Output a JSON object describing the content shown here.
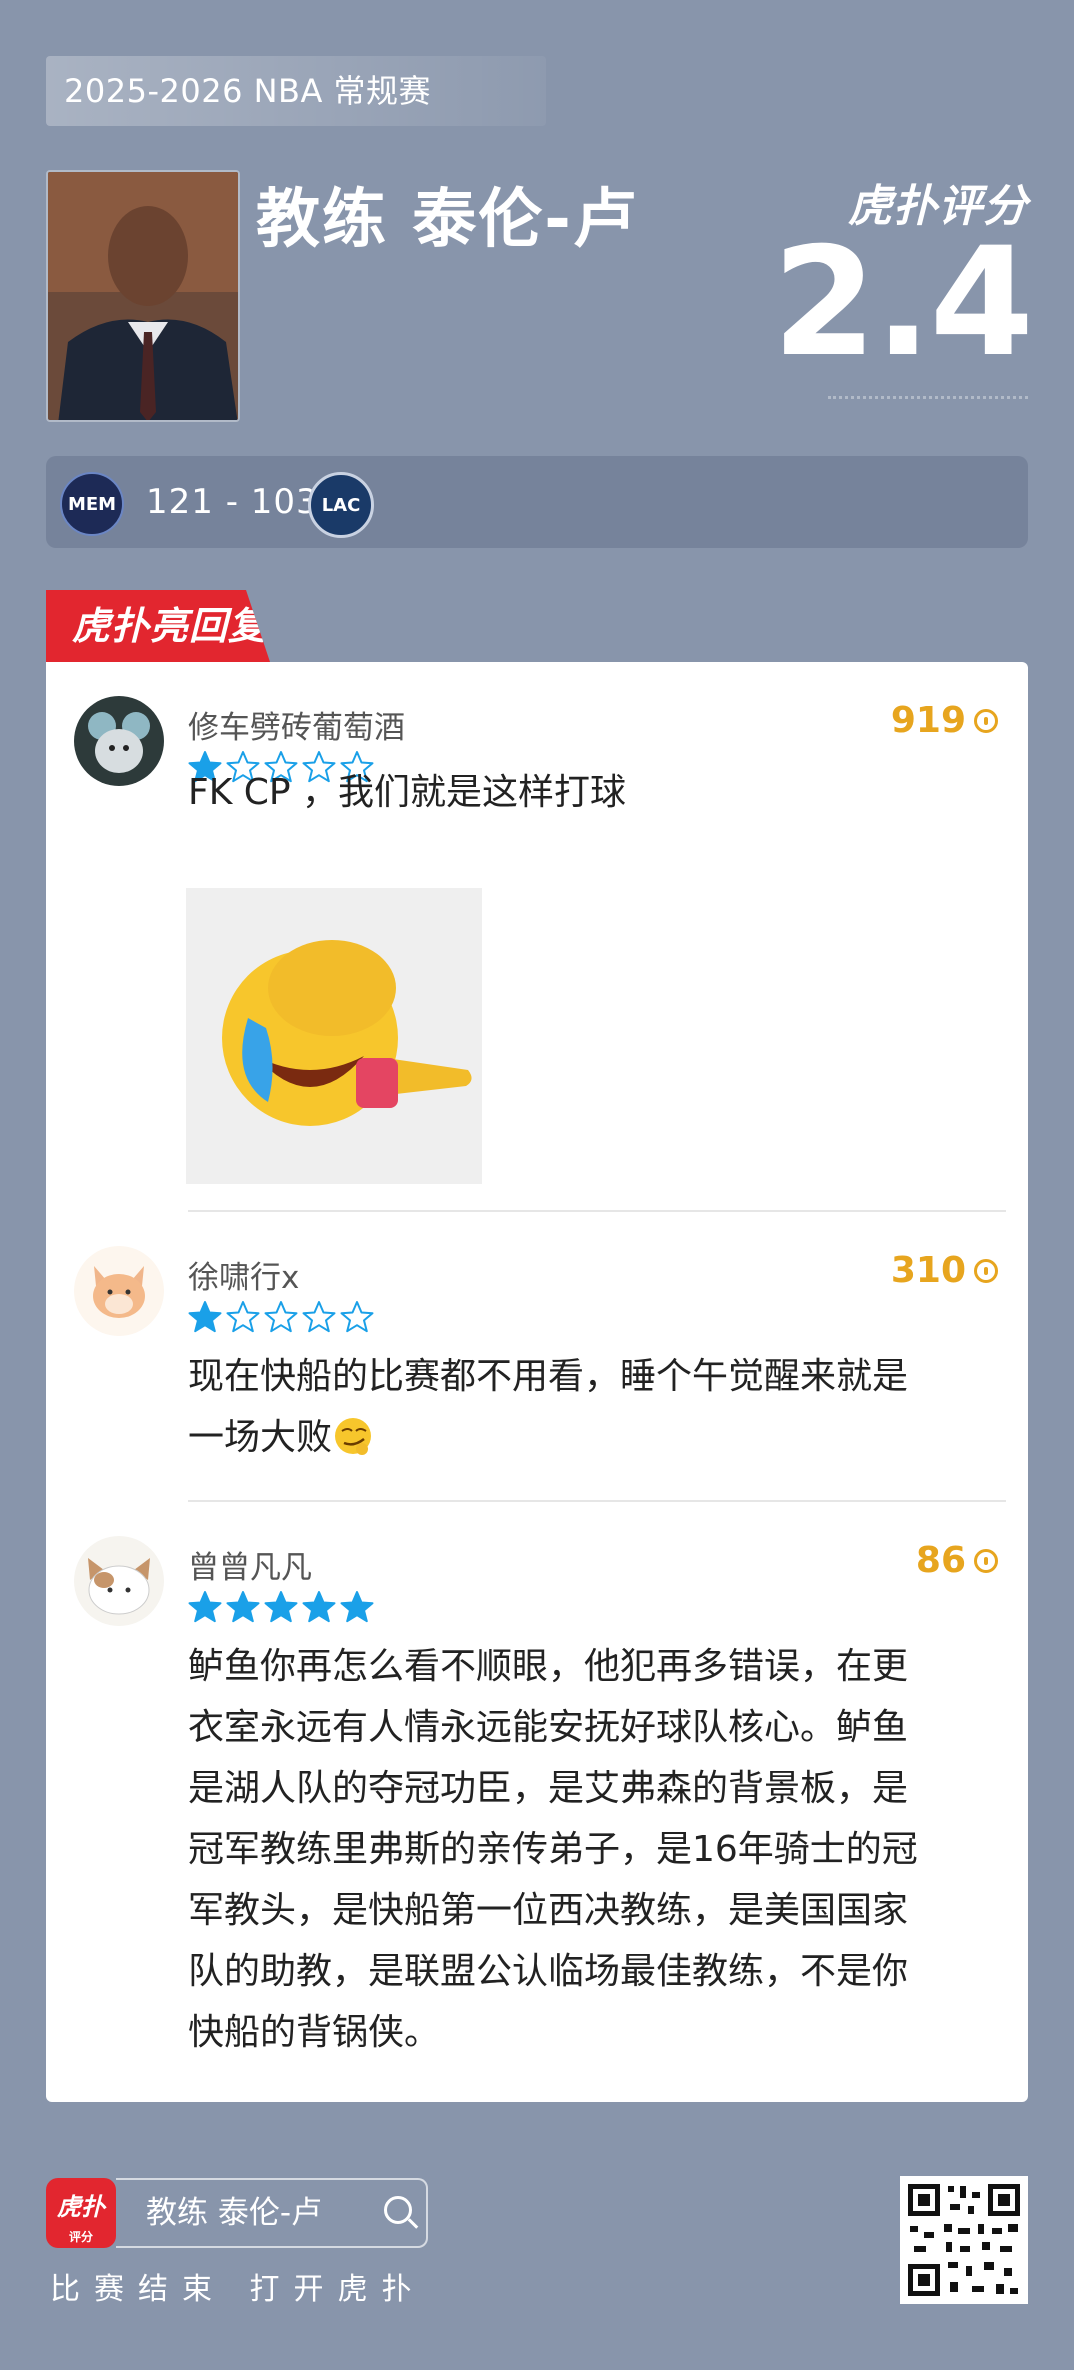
{
  "header": {
    "season": "2025-2026 NBA 常规赛",
    "coach_name": "教练 泰伦-卢",
    "rating_brand": "虎扑评分",
    "rating_score": "2.4"
  },
  "game": {
    "home_team": "MEM",
    "away_team": "LAC",
    "score": "121 - 103"
  },
  "section_tab": "虎扑亮回复",
  "comments": [
    {
      "username": "修车劈砖葡萄酒",
      "likes": "919",
      "rating": 1,
      "text": "FK CP ，我们就是这样打球",
      "has_image": true,
      "image_icon": "facepalm-crying-pointing-emoji"
    },
    {
      "username": "徐啸行x",
      "likes": "310",
      "rating": 1,
      "text_line1": "现在快船的比赛都不用看，睡个午觉醒来就是",
      "text_line2": "一场大败",
      "inline_icon": "smug-emoji"
    },
    {
      "username": "曾曾凡凡",
      "likes": "86",
      "rating": 5,
      "lines": [
        "鲈鱼你再怎么看不顺眼，他犯再多错误，在更",
        "衣室永远有人情永远能安抚好球队核心。鲈鱼",
        "是湖人队的夺冠功臣，是艾弗森的背景板，是",
        "冠军教练里弗斯的亲传弟子，是16年骑士的冠",
        "军教头，是快船第一位西决教练，是美国国家",
        "队的助教，是联盟公认临场最佳教练，不是你",
        "快船的背锅侠。"
      ]
    }
  ],
  "footer": {
    "logo_text": "虎扑",
    "logo_sub": "评分",
    "search_text": "教练 泰伦-卢",
    "caption": "比赛结束 打开虎扑"
  },
  "colors": {
    "background": "#8895ab",
    "accent_red": "#e2262f",
    "likes_gold": "#e7a51e",
    "star_blue": "#1aa0e8"
  }
}
